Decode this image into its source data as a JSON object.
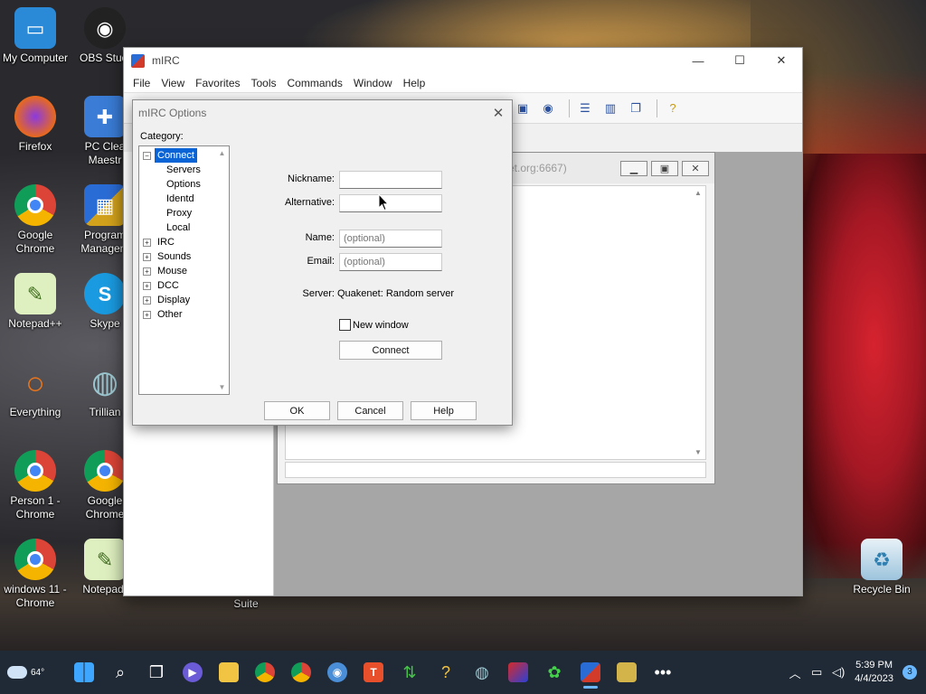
{
  "desktop": {
    "icons": [
      {
        "label": "My Computer",
        "glyph": "▭",
        "color": "#2a8ad8"
      },
      {
        "label": "OBS Studi",
        "glyph": "◉",
        "color": "#222222"
      },
      {
        "label": "Firefox",
        "glyph": "●",
        "color": "#e86a1c"
      },
      {
        "label": "PC Clea Maestr",
        "glyph": "✚",
        "color": "#3a7cd6"
      },
      {
        "label": "Google Chrome",
        "glyph": "◎",
        "color": "#2f9a46"
      },
      {
        "label": "Program Managem",
        "glyph": "▦",
        "color": "#d2a21c"
      },
      {
        "label": "Notepad++",
        "glyph": "✎",
        "color": "#86b84a"
      },
      {
        "label": "Skype",
        "glyph": "S",
        "color": "#1a9ae0"
      },
      {
        "label": "Everything",
        "glyph": "○",
        "color": "#e8741c"
      },
      {
        "label": "Trillian",
        "glyph": "◍",
        "color": "#4d8fa0"
      },
      {
        "label": "Person 1 - Chrome",
        "glyph": "◎",
        "color": "#2f9a46"
      },
      {
        "label": "Google Chrome",
        "glyph": "◎",
        "color": "#2f9a46"
      },
      {
        "label": "windows 11 - Chrome",
        "glyph": "◎",
        "color": "#2f9a46"
      },
      {
        "label": "Notepad-",
        "glyph": "✎",
        "color": "#86b84a"
      },
      {
        "label": "Suite",
        "glyph": "",
        "color": "transparent"
      },
      {
        "label": "Recycle Bin",
        "glyph": "♻",
        "color": "#6fa7c7"
      }
    ]
  },
  "mirc": {
    "title": "mIRC",
    "menu": [
      "File",
      "View",
      "Favorites",
      "Tools",
      "Commands",
      "Window",
      "Help"
    ],
    "status_title_fragment": "et.org:6667)"
  },
  "options_dialog": {
    "title": "mIRC Options",
    "category_label": "Category:",
    "tree": [
      {
        "label": "Connect",
        "level": 0,
        "expander": "−",
        "selected": true
      },
      {
        "label": "Servers",
        "level": 1
      },
      {
        "label": "Options",
        "level": 1
      },
      {
        "label": "Identd",
        "level": 1
      },
      {
        "label": "Proxy",
        "level": 1
      },
      {
        "label": "Local",
        "level": 1
      },
      {
        "label": "IRC",
        "level": 0,
        "expander": "+"
      },
      {
        "label": "Sounds",
        "level": 0,
        "expander": "+"
      },
      {
        "label": "Mouse",
        "level": 0,
        "expander": "+"
      },
      {
        "label": "DCC",
        "level": 0,
        "expander": "+"
      },
      {
        "label": "Display",
        "level": 0,
        "expander": "+"
      },
      {
        "label": "Other",
        "level": 0,
        "expander": "+"
      }
    ],
    "fields": {
      "nickname_label": "Nickname:",
      "nickname_value": "",
      "alternative_label": "Alternative:",
      "alternative_value": "",
      "name_label": "Name:",
      "name_placeholder": "(optional)",
      "email_label": "Email:",
      "email_placeholder": "(optional)"
    },
    "server_label": "Server:",
    "server_value": "Quakenet: Random server",
    "new_window_label": "New window",
    "new_window_checked": false,
    "connect_button": "Connect",
    "ok_button": "OK",
    "cancel_button": "Cancel",
    "help_button": "Help"
  },
  "taskbar": {
    "weather_temp": "64°",
    "time": "5:39 PM",
    "date": "4/4/2023",
    "notification_count": "3"
  }
}
